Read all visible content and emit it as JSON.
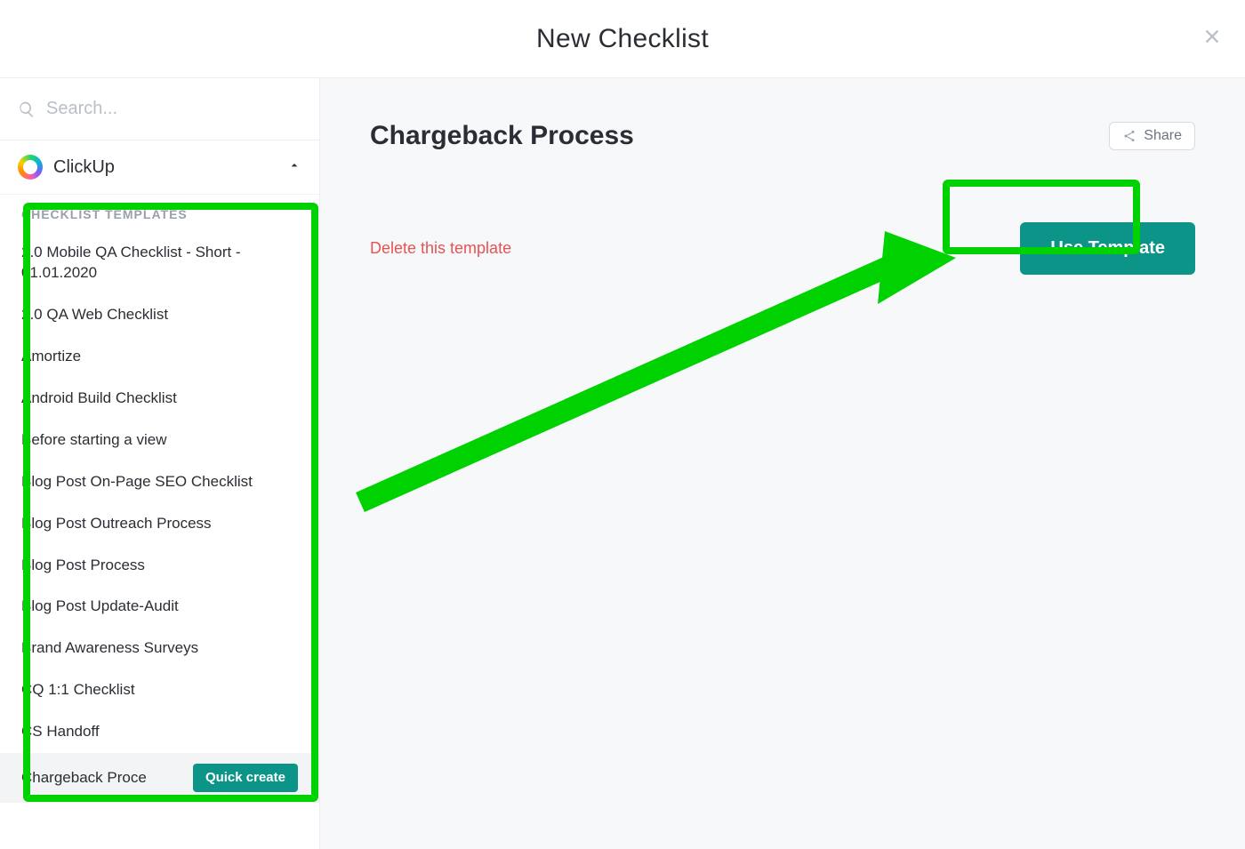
{
  "modal": {
    "title": "New Checklist"
  },
  "sidebar": {
    "search_placeholder": "Search...",
    "workspace_name": "ClickUp",
    "section_heading": "CHECKLIST TEMPLATES",
    "templates": [
      {
        "label": "2.0 Mobile QA Checklist - Short - 01.01.2020",
        "selected": false
      },
      {
        "label": "2.0 QA Web Checklist",
        "selected": false
      },
      {
        "label": "Amortize",
        "selected": false
      },
      {
        "label": "Android Build Checklist",
        "selected": false
      },
      {
        "label": "Before starting a view",
        "selected": false
      },
      {
        "label": "Blog Post On-Page SEO Checklist",
        "selected": false
      },
      {
        "label": "Blog Post Outreach Process",
        "selected": false
      },
      {
        "label": "Blog Post Process",
        "selected": false
      },
      {
        "label": "Blog Post Update-Audit",
        "selected": false
      },
      {
        "label": "Brand Awareness Surveys",
        "selected": false
      },
      {
        "label": "CQ 1:1 Checklist",
        "selected": false
      },
      {
        "label": "CS Handoff",
        "selected": false
      },
      {
        "label": "Chargeback Proce",
        "selected": true
      }
    ],
    "quick_create_label": "Quick create"
  },
  "main": {
    "template_title": "Chargeback Process",
    "share_label": "Share",
    "delete_label": "Delete this template",
    "use_template_label": "Use Template"
  },
  "annotation": {
    "color": "#00d100"
  }
}
